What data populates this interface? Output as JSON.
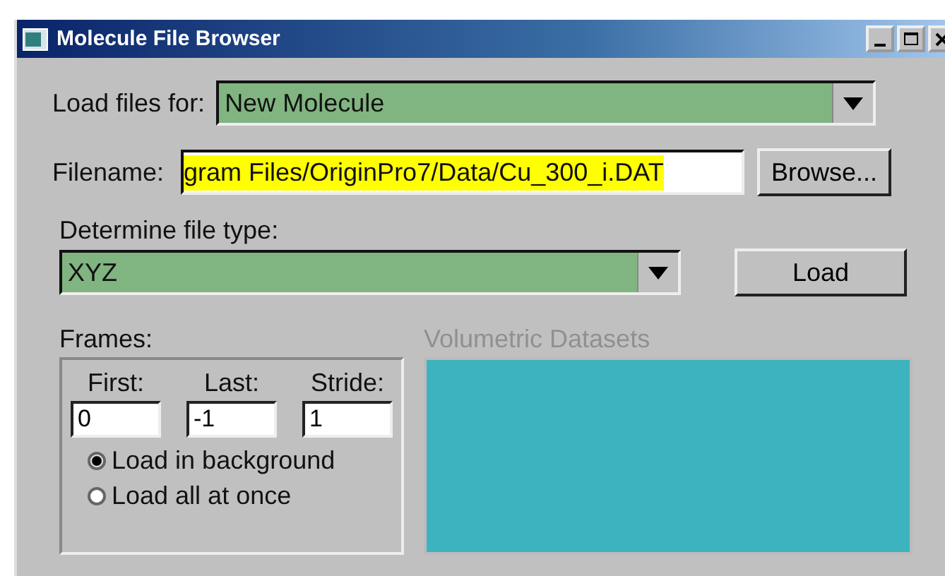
{
  "window": {
    "title": "Molecule File Browser"
  },
  "load_files_for": {
    "label": "Load files for:",
    "value": "New Molecule"
  },
  "filename": {
    "label": "Filename:",
    "value": "gram Files/OriginPro7/Data/Cu_300_i.DAT",
    "button": "Browse..."
  },
  "file_type": {
    "label": "Determine file type:",
    "value": "XYZ",
    "button": "Load"
  },
  "frames": {
    "label": "Frames:",
    "fields": [
      {
        "label": "First:",
        "value": "0"
      },
      {
        "label": "Last:",
        "value": "-1"
      },
      {
        "label": "Stride:",
        "value": "1"
      }
    ],
    "options": [
      {
        "label": "Load in background",
        "selected": true
      },
      {
        "label": "Load all at once",
        "selected": false
      }
    ]
  },
  "volumetric": {
    "label": "Volumetric Datasets",
    "disabled": true
  }
}
